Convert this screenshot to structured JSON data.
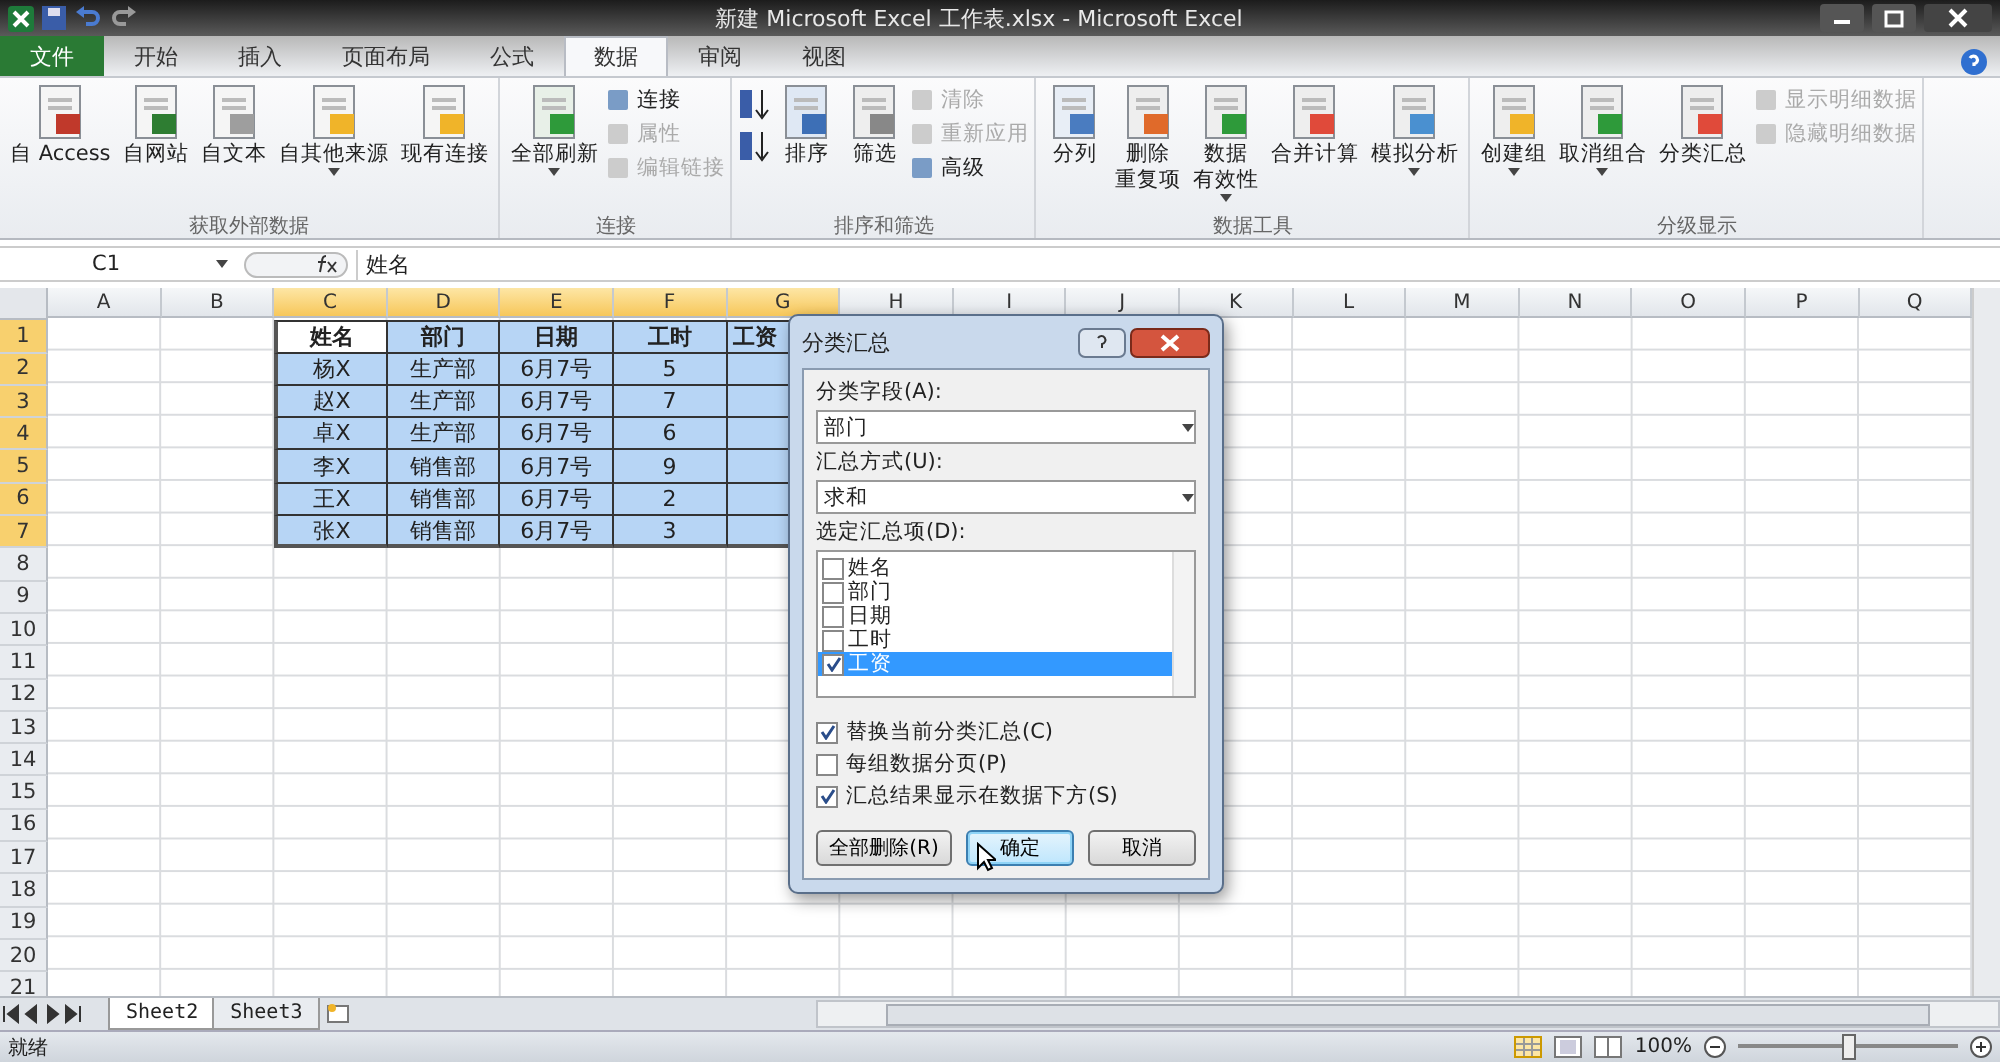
{
  "window": {
    "title": "新建 Microsoft Excel 工作表.xlsx - Microsoft Excel"
  },
  "tabs": [
    {
      "label": "文件",
      "selected": false,
      "kind": "file"
    },
    {
      "label": "开始",
      "selected": false,
      "kind": "tab"
    },
    {
      "label": "插入",
      "selected": false,
      "kind": "tab"
    },
    {
      "label": "页面布局",
      "selected": false,
      "kind": "tab"
    },
    {
      "label": "公式",
      "selected": false,
      "kind": "tab"
    },
    {
      "label": "数据",
      "selected": true,
      "kind": "tab"
    },
    {
      "label": "审阅",
      "selected": false,
      "kind": "tab"
    },
    {
      "label": "视图",
      "selected": false,
      "kind": "tab"
    }
  ],
  "ribbon": {
    "groups": [
      {
        "label": "获取外部数据",
        "buttons": [
          {
            "kind": "large",
            "label": "自 Access",
            "disabled": false
          },
          {
            "kind": "large",
            "label": "自网站",
            "disabled": false
          },
          {
            "kind": "large",
            "label": "自文本",
            "disabled": false
          },
          {
            "kind": "large",
            "label": "自其他来源",
            "disabled": false,
            "dropdown": true
          },
          {
            "kind": "large",
            "label": "现有连接",
            "disabled": false
          }
        ]
      },
      {
        "label": "连接",
        "buttons": [
          {
            "kind": "large",
            "label": "全部刷新",
            "disabled": false,
            "dropdown": true
          },
          {
            "kind": "small",
            "label": "连接",
            "disabled": false
          },
          {
            "kind": "small",
            "label": "属性",
            "disabled": true
          },
          {
            "kind": "small",
            "label": "编辑链接",
            "disabled": true
          }
        ]
      },
      {
        "label": "排序和筛选",
        "buttons": [
          {
            "kind": "icon",
            "disabled": false
          },
          {
            "kind": "icon",
            "disabled": false
          },
          {
            "kind": "large",
            "label": "排序",
            "disabled": false
          },
          {
            "kind": "large",
            "label": "筛选",
            "disabled": false
          },
          {
            "kind": "small",
            "label": "清除",
            "disabled": true
          },
          {
            "kind": "small",
            "label": "重新应用",
            "disabled": true
          },
          {
            "kind": "small",
            "label": "高级",
            "disabled": false
          }
        ]
      },
      {
        "label": "数据工具",
        "buttons": [
          {
            "kind": "large",
            "label": "分列",
            "disabled": false
          },
          {
            "kind": "large",
            "lines": [
              "删除",
              "重复项"
            ],
            "disabled": false
          },
          {
            "kind": "large",
            "lines": [
              "数据",
              "有效性"
            ],
            "disabled": false,
            "dropdown": true
          },
          {
            "kind": "large",
            "label": "合并计算",
            "disabled": false
          },
          {
            "kind": "large",
            "label": "模拟分析",
            "disabled": false,
            "dropdown": true
          }
        ]
      },
      {
        "label": "分级显示",
        "buttons": [
          {
            "kind": "large",
            "label": "创建组",
            "disabled": false,
            "dropdown": true
          },
          {
            "kind": "large",
            "label": "取消组合",
            "disabled": false,
            "dropdown": true
          },
          {
            "kind": "large",
            "label": "分类汇总",
            "disabled": false
          },
          {
            "kind": "small",
            "label": "显示明细数据",
            "disabled": true
          },
          {
            "kind": "small",
            "label": "隐藏明细数据",
            "disabled": true
          }
        ]
      }
    ]
  },
  "formula_bar": {
    "name_box": "C1",
    "value": "姓名"
  },
  "grid": {
    "columns": [
      {
        "label": "A",
        "selected": false
      },
      {
        "label": "B",
        "selected": false
      },
      {
        "label": "C",
        "selected": true
      },
      {
        "label": "D",
        "selected": true
      },
      {
        "label": "E",
        "selected": true
      },
      {
        "label": "F",
        "selected": true
      },
      {
        "label": "G",
        "selected": true
      },
      {
        "label": "H",
        "selected": false
      },
      {
        "label": "I",
        "selected": false
      },
      {
        "label": "J",
        "selected": false
      },
      {
        "label": "K",
        "selected": false
      },
      {
        "label": "L",
        "selected": false
      },
      {
        "label": "M",
        "selected": false
      },
      {
        "label": "N",
        "selected": false
      },
      {
        "label": "O",
        "selected": false
      },
      {
        "label": "P",
        "selected": false
      },
      {
        "label": "Q",
        "selected": false
      }
    ],
    "rows": [
      {
        "label": "1",
        "selected": true
      },
      {
        "label": "2",
        "selected": true
      },
      {
        "label": "3",
        "selected": true
      },
      {
        "label": "4",
        "selected": true
      },
      {
        "label": "5",
        "selected": true
      },
      {
        "label": "6",
        "selected": true
      },
      {
        "label": "7",
        "selected": true
      },
      {
        "label": "8",
        "selected": false
      },
      {
        "label": "9",
        "selected": false
      },
      {
        "label": "10",
        "selected": false
      },
      {
        "label": "11",
        "selected": false
      },
      {
        "label": "12",
        "selected": false
      },
      {
        "label": "13",
        "selected": false
      },
      {
        "label": "14",
        "selected": false
      },
      {
        "label": "15",
        "selected": false
      },
      {
        "label": "16",
        "selected": false
      },
      {
        "label": "17",
        "selected": false
      },
      {
        "label": "18",
        "selected": false
      },
      {
        "label": "19",
        "selected": false
      },
      {
        "label": "20",
        "selected": false
      },
      {
        "label": "21",
        "selected": false
      }
    ],
    "table": {
      "header": [
        {
          "text": "姓名",
          "active": true
        },
        {
          "text": "部门",
          "active": false
        },
        {
          "text": "日期",
          "active": false
        },
        {
          "text": "工时",
          "active": false
        },
        {
          "text": "工资",
          "active": false
        }
      ],
      "rows": [
        [
          "杨X",
          "生产部",
          "6月7号",
          "5"
        ],
        [
          "赵X",
          "生产部",
          "6月7号",
          "7"
        ],
        [
          "卓X",
          "生产部",
          "6月7号",
          "6"
        ],
        [
          "李X",
          "销售部",
          "6月7号",
          "9"
        ],
        [
          "王X",
          "销售部",
          "6月7号",
          "2"
        ],
        [
          "张X",
          "销售部",
          "6月7号",
          "3"
        ]
      ]
    }
  },
  "dialog": {
    "title": "分类汇总",
    "field_label": "分类字段(A):",
    "field_value": "部门",
    "method_label": "汇总方式(U):",
    "method_value": "求和",
    "items_label": "选定汇总项(D):",
    "items": [
      {
        "label": "姓名",
        "checked": false,
        "selected": false
      },
      {
        "label": "部门",
        "checked": false,
        "selected": false
      },
      {
        "label": "日期",
        "checked": false,
        "selected": false
      },
      {
        "label": "工时",
        "checked": false,
        "selected": false
      },
      {
        "label": "工资",
        "checked": true,
        "selected": true
      }
    ],
    "options": [
      {
        "label": "替换当前分类汇总(C)",
        "checked": true
      },
      {
        "label": "每组数据分页(P)",
        "checked": false
      },
      {
        "label": "汇总结果显示在数据下方(S)",
        "checked": true
      }
    ],
    "buttons": [
      {
        "label": "全部删除(R)",
        "selected": false
      },
      {
        "label": "确定",
        "selected": true
      },
      {
        "label": "取消",
        "selected": false
      }
    ]
  },
  "sheet_tabs": [
    {
      "label": "Sheet2",
      "selected": true
    },
    {
      "label": "Sheet3",
      "selected": false
    }
  ],
  "status_bar": {
    "status": "就绪",
    "zoom": "100%",
    "zoom_slider": {
      "level": 0.5
    }
  }
}
